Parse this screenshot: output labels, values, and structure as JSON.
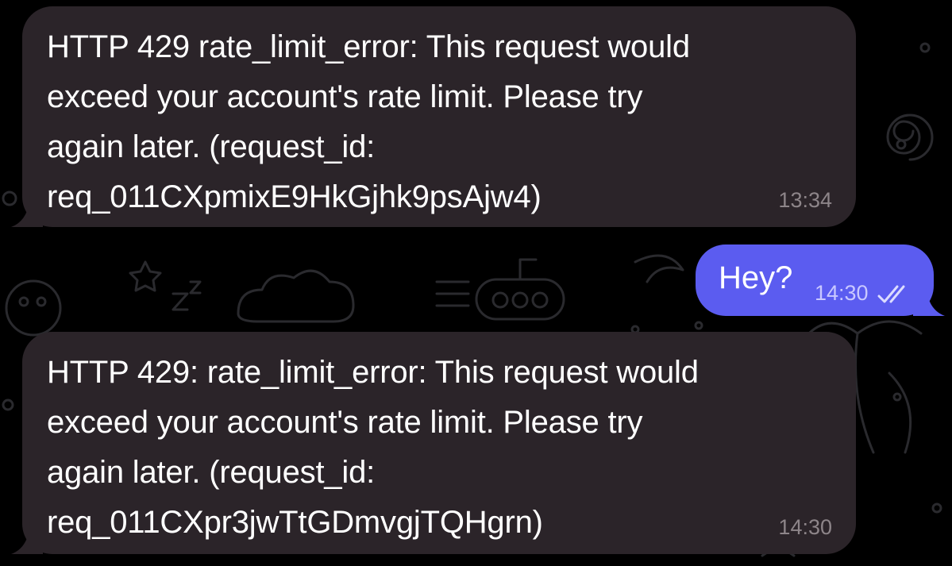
{
  "chat": {
    "messages": [
      {
        "direction": "incoming",
        "text": "HTTP 429 rate_limit_error: This request would\nexceed your account's rate limit. Please try\nagain later. (request_id:\nreq_011CXpmixE9HkGjhk9psAjw4)",
        "time": "13:34"
      },
      {
        "direction": "outgoing",
        "text": "Hey?",
        "time": "14:30",
        "status_icon": "double-check-icon"
      },
      {
        "direction": "incoming",
        "text": "HTTP 429: rate_limit_error: This request would\nexceed your account's rate limit. Please try\nagain later. (request_id:\nreq_011CXpr3jwTtGDmvgjTQHgrn)",
        "time": "14:30"
      }
    ]
  },
  "colors": {
    "background": "#000000",
    "incoming_bubble": "#2b2429",
    "outgoing_bubble": "#5b5cf0",
    "incoming_time": "#8d8589",
    "outgoing_time": "#c9c8ff"
  }
}
